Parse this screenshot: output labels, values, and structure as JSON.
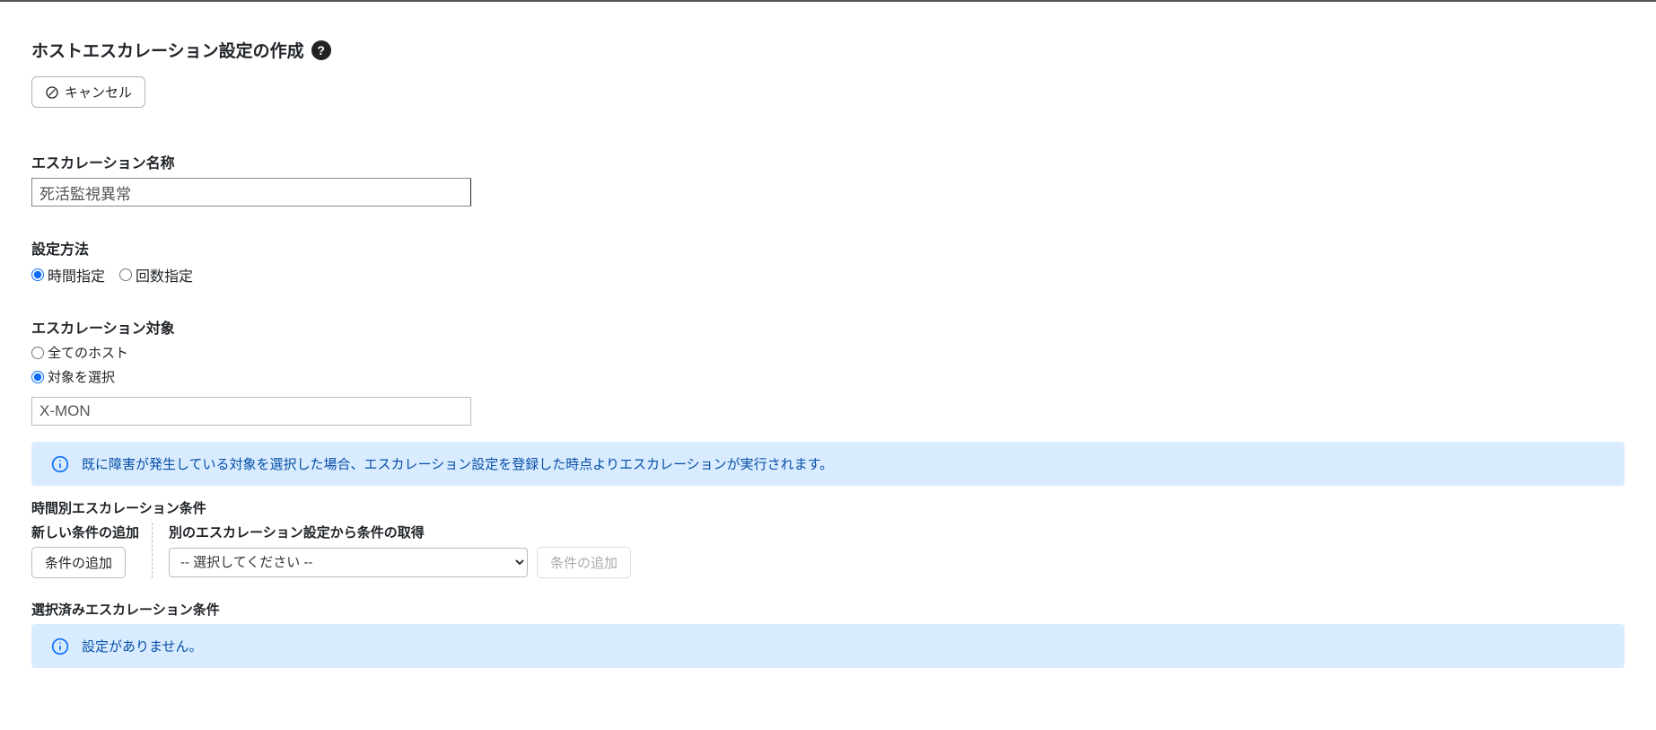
{
  "page": {
    "title": "ホストエスカレーション設定の作成"
  },
  "actions": {
    "cancel_label": "キャンセル"
  },
  "name": {
    "label": "エスカレーション名称",
    "value": "死活監視異常"
  },
  "method": {
    "label": "設定方法",
    "option_time": "時間指定",
    "option_count": "回数指定"
  },
  "target": {
    "label": "エスカレーション対象",
    "option_all": "全てのホスト",
    "option_select": "対象を選択",
    "value": "X-MON"
  },
  "banner": {
    "text": "既に障害が発生している対象を選択した場合、エスカレーション設定を登録した時点よりエスカレーションが実行されます。"
  },
  "conditions": {
    "heading": "時間別エスカレーション条件",
    "add_col_label": "新しい条件の追加",
    "add_button": "条件の追加",
    "import_col_label": "別のエスカレーション設定から条件の取得",
    "import_placeholder": "-- 選択してください --",
    "import_button": "条件の追加"
  },
  "selected": {
    "heading": "選択済みエスカレーション条件",
    "empty_text": "設定がありません。"
  }
}
